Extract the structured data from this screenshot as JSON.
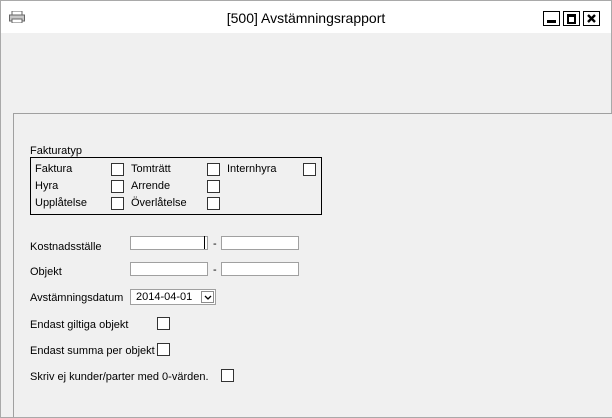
{
  "window": {
    "title": "[500]  Avstämningsrapport"
  },
  "fakturatyp": {
    "label": "Fakturatyp",
    "items": [
      {
        "label": "Faktura"
      },
      {
        "label": "Hyra"
      },
      {
        "label": "Upplåtelse"
      },
      {
        "label": "Tomträtt"
      },
      {
        "label": "Arrende"
      },
      {
        "label": "Överlåtelse"
      },
      {
        "label": "Internhyra"
      }
    ]
  },
  "form": {
    "kostnadsstalle_label": "Kostnadsställe",
    "objekt_label": "Objekt",
    "range_separator": "-",
    "avstamningsdatum_label": "Avstämningsdatum",
    "avstamningsdatum_value": "2014-04-01",
    "endast_giltiga_label": "Endast giltiga objekt",
    "endast_summa_label": "Endast summa per objekt",
    "skriv_ej_label": "Skriv ej kunder/parter med 0-värden."
  }
}
